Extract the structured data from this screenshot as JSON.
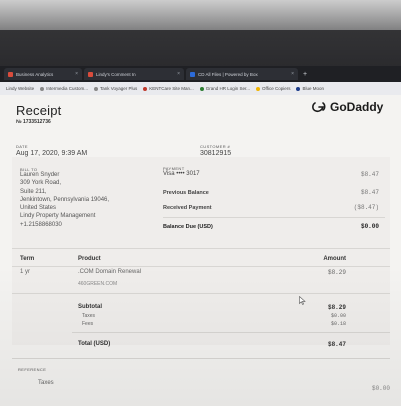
{
  "browser": {
    "tabs": [
      {
        "label": "Business Analytics",
        "color": "#d94c3c"
      },
      {
        "label": "Lindy's Comment In",
        "color": "#d94c3c"
      },
      {
        "label": "CD All Files | Powered by Box",
        "color": "#2c6bd9"
      }
    ],
    "new_tab_label": "+"
  },
  "bookmarks": [
    "Lindy Website",
    "Intermedia Custom...",
    "Tank Voyager Plus",
    "KENTCare Site Man...",
    "Grand HR Login Ser...",
    "Office Copiers",
    "Blue Moon"
  ],
  "receipt": {
    "title": "Receipt",
    "number": "№ 1733512736",
    "brand": "GoDaddy",
    "date_label": "DATE",
    "date_value": "Aug 17, 2020, 9:39 AM",
    "customer_label": "CUSTOMER #",
    "customer_value": "30812915",
    "bill_to_label": "BILL TO",
    "bill_to_lines": [
      "Lauren Snyder",
      "309 York Road,",
      "Suite 211,",
      "Jenkintown, Pennsylvania 19046,",
      "United States",
      "Lindy Property Management",
      "+1.2158868030"
    ],
    "payment_label": "PAYMENT",
    "payment_method": "Visa •••• 3017",
    "payment_amount": "$8.47",
    "previous_balance_label": "Previous Balance",
    "previous_balance": "$8.47",
    "received_payment_label": "Received Payment",
    "received_payment": "($8.47)",
    "balance_due_label": "Balance Due (USD)",
    "balance_due": "$0.00",
    "table": {
      "col_term": "Term",
      "col_product": "Product",
      "col_amount": "Amount",
      "term": "1 yr",
      "product": ".COM Domain Renewal",
      "domain": "460GREEN.COM",
      "amount": "$8.29"
    },
    "subtotal_label": "Subtotal",
    "subtotal": "$8.29",
    "taxes_label": "Taxes",
    "taxes": "$0.00",
    "fees_label": "Fees",
    "fees": "$0.18",
    "total_label": "Total (USD)",
    "total": "$8.47",
    "reference_label": "REFERENCE",
    "ref_taxes_label": "Taxes",
    "ref_taxes": "$0.00"
  }
}
